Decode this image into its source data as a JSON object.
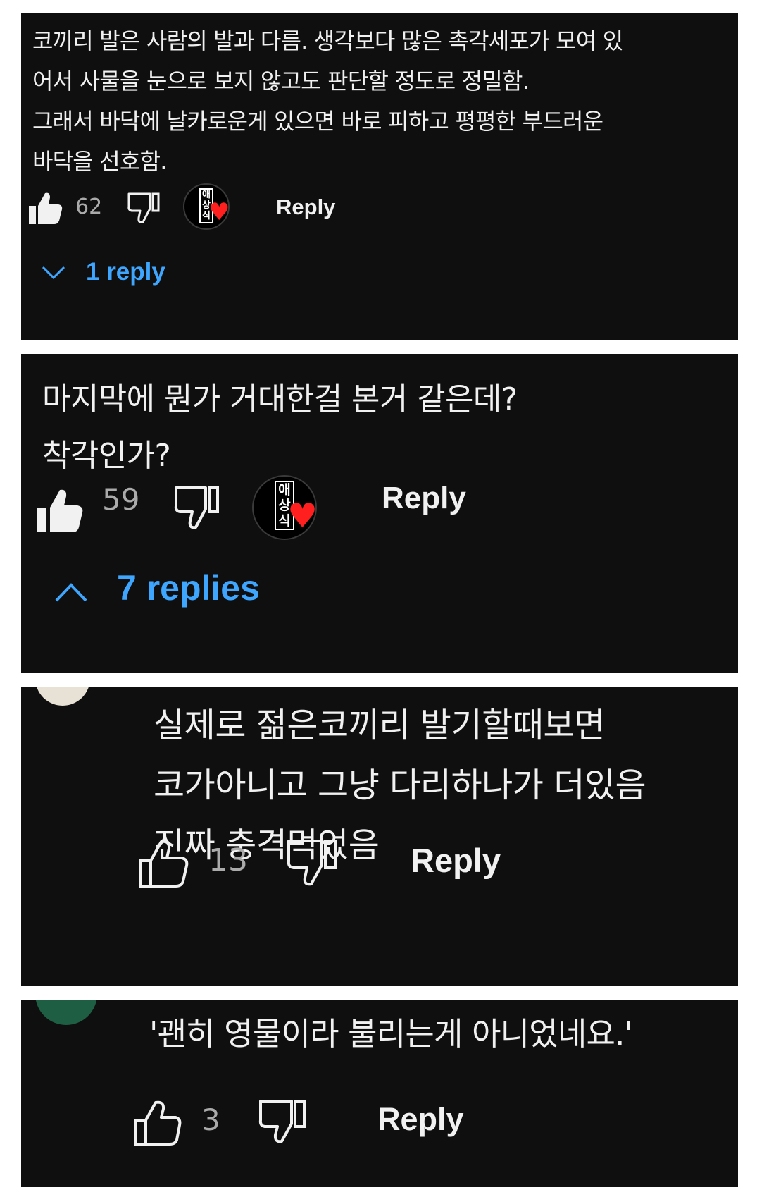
{
  "comments": [
    {
      "text": "코끼리 발은 사람의 발과 다름. 생각보다 많은 촉각세포가 모여 있\n어서 사물을 눈으로 보지 않고도 판단할 정도로 정밀함.\n그래서 바닥에 날카로운게 있으면 바로 피하고 평평한 부드러운\n바닥을 선호함.",
      "likes": "62",
      "reply_label": "Reply",
      "creator_badge_text": "애상식",
      "replies_label": "1 reply",
      "replies_state": "collapsed",
      "creator_hearted": true
    },
    {
      "text": "마지막에 뭔가 거대한걸 본거 같은데?\n착각인가?",
      "likes": "59",
      "reply_label": "Reply",
      "creator_badge_text": "애상식",
      "replies_label": "7 replies",
      "replies_state": "expanded",
      "creator_hearted": true
    },
    {
      "text": "실제로 젊은코끼리 발기할때보면\n코가아니고 그냥 다리하나가 더있음\n진짜 충격먹었음",
      "likes": "13",
      "reply_label": "Reply"
    },
    {
      "text": "'괜히 영물이라 불리는게 아니었네요.'",
      "likes": "3",
      "reply_label": "Reply"
    }
  ],
  "colors": {
    "panel_bg": "#0f0f0f",
    "text": "#f1f1f1",
    "count": "#aaaaaa",
    "link_blue": "#3ea6ff",
    "heart": "#ff1f1f",
    "avatar_green": "#1e5e43"
  },
  "icons": {
    "like_filled": "thumbs-up-filled-icon",
    "like_outline": "thumbs-up-outline-icon",
    "dislike": "thumbs-down-outline-icon",
    "chevron_down": "chevron-down-icon",
    "chevron_up": "chevron-up-icon",
    "heart": "heart-icon"
  }
}
